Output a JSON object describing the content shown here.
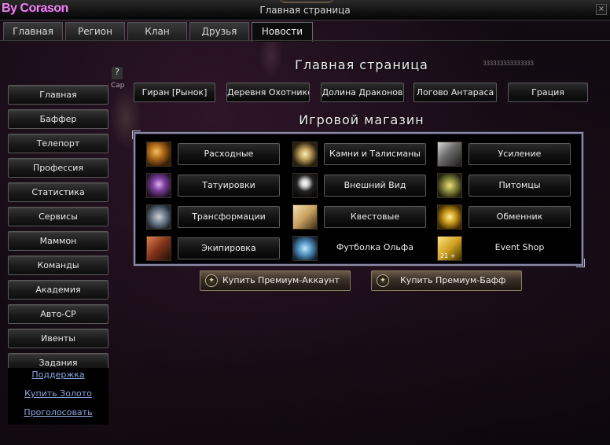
{
  "window": {
    "brand": "By Corason",
    "title": "Главная страница",
    "close_label": "×"
  },
  "tabs": [
    {
      "label": "Главная",
      "active": false
    },
    {
      "label": "Регион",
      "active": false
    },
    {
      "label": "Клан",
      "active": false
    },
    {
      "label": "Друзья",
      "active": false
    },
    {
      "label": "Новости",
      "active": true
    }
  ],
  "left_menu": [
    "Главная",
    "Баффер",
    "Телепорт",
    "Профессия",
    "Статистика",
    "Сервисы",
    "Маммон",
    "Команды",
    "Академия",
    "Авто-СР",
    "Ивенты",
    "Задания"
  ],
  "links": [
    "Поддержка",
    "Купить Золото",
    "Проголосовать"
  ],
  "main": {
    "heading": "Главная страница",
    "counter": "333333333333333",
    "locations": [
      "Гиран [Рынок]",
      "Деревня Охотников",
      "Долина Драконов",
      "Логово Антараса",
      "Грация"
    ],
    "shop_heading": "Игровой магазин"
  },
  "shop": [
    {
      "label": "Расходные",
      "icon": "consumables-icon",
      "style": "button"
    },
    {
      "label": "Камни и Талисманы",
      "icon": "gems-icon",
      "style": "button"
    },
    {
      "label": "Усиление",
      "icon": "enhance-icon",
      "style": "button"
    },
    {
      "label": "Татуировки",
      "icon": "tattoo-icon",
      "style": "button"
    },
    {
      "label": "Внешний Вид",
      "icon": "appearance-icon",
      "style": "button"
    },
    {
      "label": "Питомцы",
      "icon": "pets-icon",
      "style": "button"
    },
    {
      "label": "Трансформации",
      "icon": "transform-icon",
      "style": "button"
    },
    {
      "label": "Квестовые",
      "icon": "quest-icon",
      "style": "button"
    },
    {
      "label": "Обменник",
      "icon": "exchange-icon",
      "style": "button"
    },
    {
      "label": "Экипировка",
      "icon": "equipment-icon",
      "style": "button"
    },
    {
      "label": "Футболка Ольфа",
      "icon": "shirt-icon",
      "style": "plain"
    },
    {
      "label": "Event Shop",
      "icon": "event-icon",
      "style": "plain",
      "badge": "21 +"
    }
  ],
  "premium": {
    "account_label": "Купить Премиум-Аккаунт",
    "buff_label": "Купить Премиум-Бафф",
    "icon_glyph": "✦"
  },
  "background": {
    "question_mark": "?",
    "nick": "Cap"
  }
}
